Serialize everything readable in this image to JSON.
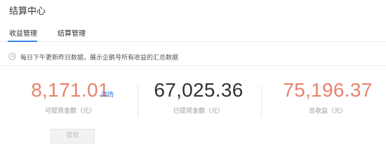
{
  "page": {
    "title": "结算中心"
  },
  "tabs": [
    {
      "label": "收益管理",
      "active": true
    },
    {
      "label": "结算管理",
      "active": false
    }
  ],
  "notice": {
    "text": "每日下午更新昨日数据，展示企鹅号所有收益的汇总数据",
    "icon": "clock-icon"
  },
  "stats": {
    "withdrawable": {
      "value": "8,171.01",
      "label": "可提现金额（元）",
      "link": "详情"
    },
    "withdrawn": {
      "value": "67,025.36",
      "label": "已提现金额（元）"
    },
    "total": {
      "value": "75,196.37",
      "label": "总收益（元）"
    }
  },
  "withdraw_button": {
    "label": "提现",
    "disabled": true
  },
  "colors": {
    "accent": "#3a83e8",
    "highlight": "#e8836b",
    "text": "#333333",
    "muted": "#999999"
  }
}
